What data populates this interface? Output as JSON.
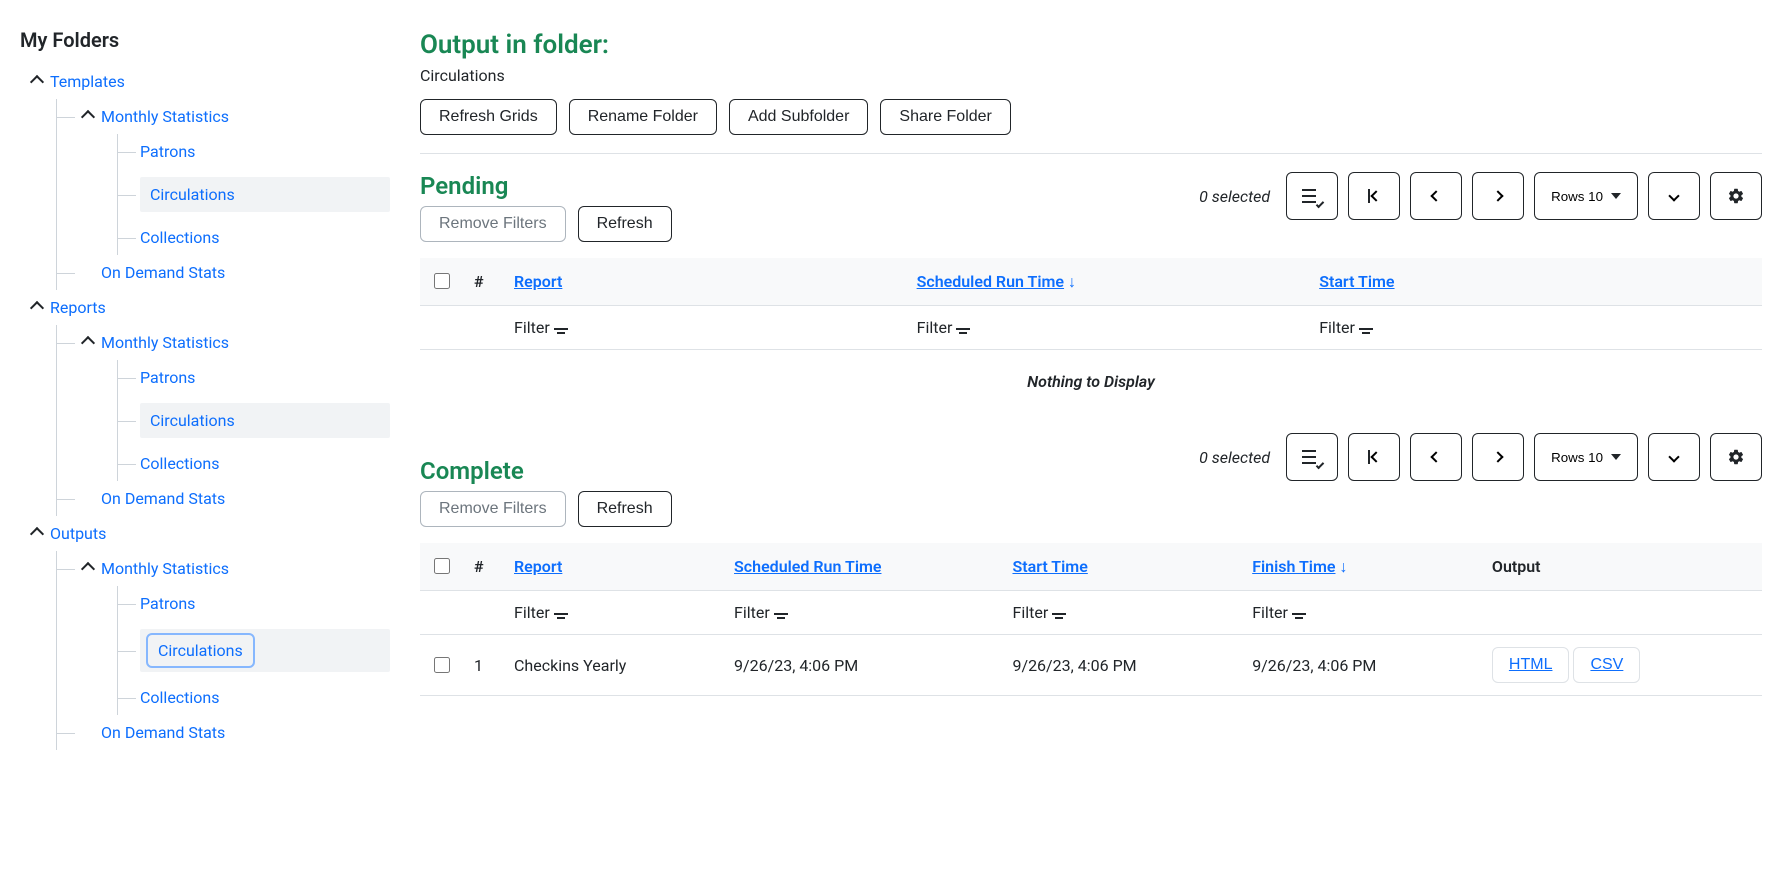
{
  "sidebar": {
    "title": "My Folders",
    "roots": {
      "templates": "Templates",
      "reports": "Reports",
      "outputs": "Outputs"
    },
    "monthly_stats": "Monthly Statistics",
    "items": {
      "patrons": "Patrons",
      "circulations": "Circulations",
      "collections": "Collections"
    },
    "on_demand": "On Demand Stats"
  },
  "header": {
    "title": "Output in folder:",
    "breadcrumb": "Circulations",
    "buttons": {
      "refresh_grids": "Refresh Grids",
      "rename_folder": "Rename Folder",
      "add_subfolder": "Add Subfolder",
      "share_folder": "Share Folder"
    }
  },
  "grid_controls": {
    "selected_text": "0 selected",
    "rows_label": "Rows 10"
  },
  "pending": {
    "title": "Pending",
    "remove_filters": "Remove Filters",
    "refresh": "Refresh",
    "columns": {
      "num": "#",
      "report": "Report",
      "scheduled": "Scheduled Run Time",
      "start": "Start Time"
    },
    "filter_label": "Filter",
    "empty": "Nothing to Display"
  },
  "complete": {
    "title": "Complete",
    "remove_filters": "Remove Filters",
    "refresh": "Refresh",
    "columns": {
      "num": "#",
      "report": "Report",
      "scheduled": "Scheduled Run Time",
      "start": "Start Time",
      "finish": "Finish Time",
      "output": "Output"
    },
    "filter_label": "Filter",
    "rows": [
      {
        "num": "1",
        "report": "Checkins Yearly",
        "scheduled": "9/26/23, 4:06 PM",
        "start": "9/26/23, 4:06 PM",
        "finish": "9/26/23, 4:06 PM",
        "html": "HTML",
        "csv": "CSV"
      }
    ]
  }
}
